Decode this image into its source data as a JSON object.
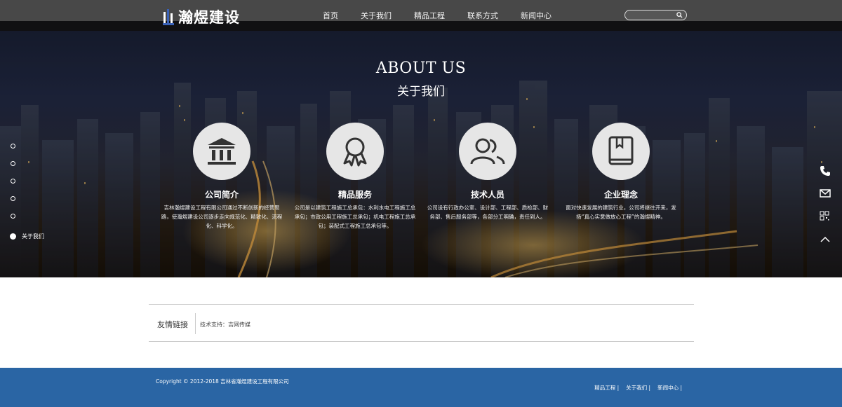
{
  "header": {
    "logo_text": "瀚煜建设",
    "nav": [
      "首页",
      "关于我们",
      "精品工程",
      "联系方式",
      "新闻中心"
    ],
    "search": {
      "placeholder": "",
      "value": ""
    }
  },
  "hero": {
    "title": "ABOUT US",
    "subtitle": "关于我们",
    "cards": [
      {
        "icon": "bank-icon",
        "title": "公司简介",
        "text": "吉林瀚煜建设工程有限公司通过不断创新的经营思路，使瀚煜建设公司逐步走向规范化、精致化、流程化、科学化。"
      },
      {
        "icon": "award-icon",
        "title": "精品服务",
        "text": "公司是以建筑工程施工总承包：水利水电工程施工总承包；市政公用工程施工总承包；机电工程施工总承包；装配式工程施工总承包等。"
      },
      {
        "icon": "people-icon",
        "title": "技术人员",
        "text": "公司设有行政办公室、设计部、工程部、质检部、财务部、售后服务部等，各部分工明确，责任到人。"
      },
      {
        "icon": "book-icon",
        "title": "企业理念",
        "text": "面对快速发展的建筑行业，公司将继往开来，发扬“真心实意做放心工程”的瀚煜精神。"
      }
    ],
    "active_section": "关于我们"
  },
  "side_icons": [
    "phone-icon",
    "mail-icon",
    "qrcode-icon",
    "chevron-up-icon"
  ],
  "links": {
    "title": "友情链接",
    "text": "技术支持：吉网传媒"
  },
  "footer": {
    "copyright": "Copyright © 2012-2018 吉林省瀚煜建设工程有限公司",
    "links": [
      "精品工程 |",
      "关于我们 |",
      "新闻中心 |"
    ]
  },
  "colors": {
    "footer_bg": "#2a65a4",
    "header_bg": "#3a3a3a",
    "icon_circle": "#e6e6e6"
  }
}
